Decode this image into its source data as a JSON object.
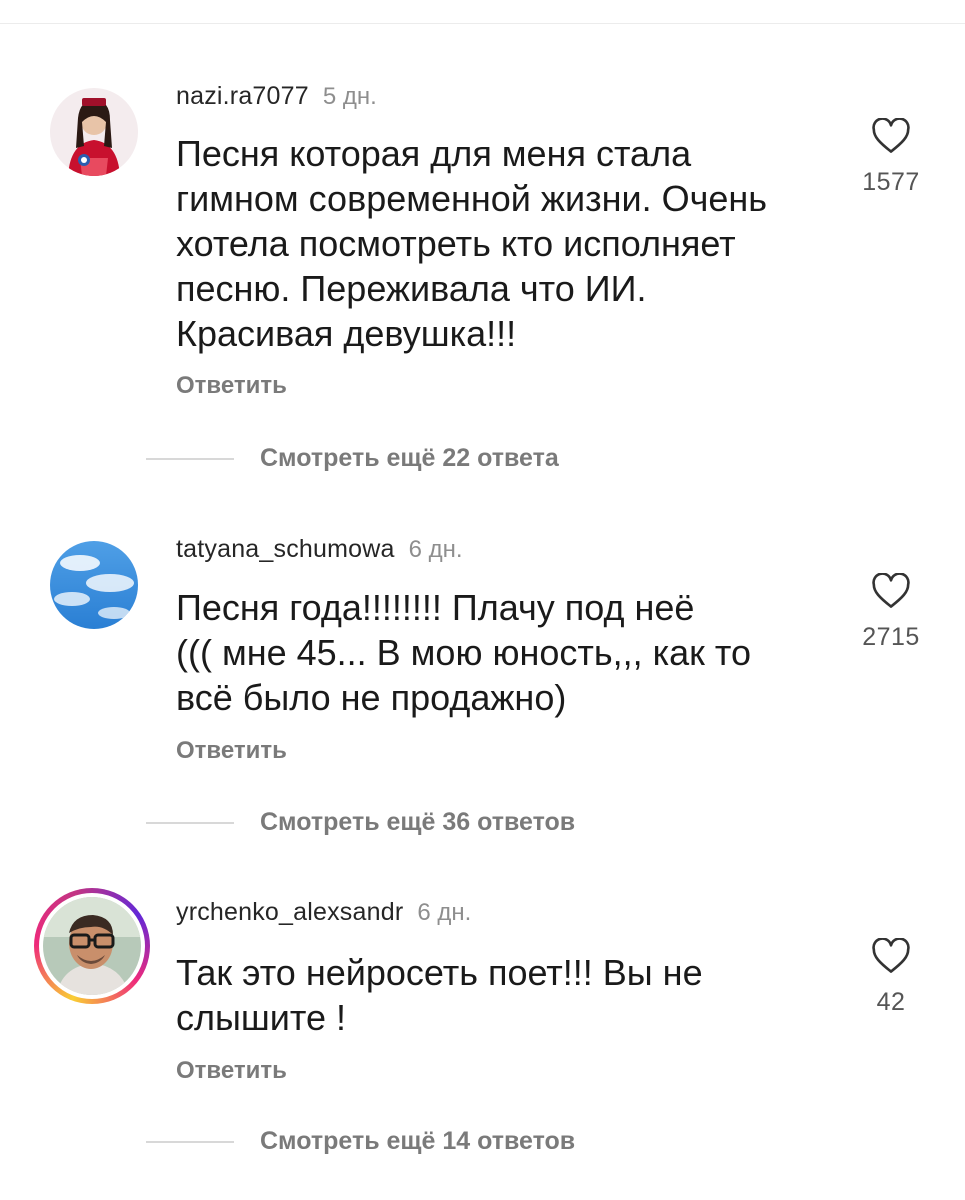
{
  "comments": [
    {
      "username": "nazi.ra7077",
      "time": "5 дн.",
      "text": "Песня которая для меня стала\nгимном современной жизни.  Очень\nхотела посмотреть кто исполняет\nпесню.  Переживала что ИИ.\nКрасивая девушка!!!",
      "likes": "1577",
      "reply_label": "Ответить",
      "more_replies": "Смотреть ещё 22 ответа",
      "avatar_icon": "avatar-woman-traditional-dress"
    },
    {
      "username": "tatyana_schumowa",
      "time": "6 дн.",
      "text": "Песня года!!!!!!!! Плачу под неё\n((( мне 45... В мою юность,,, как то\nвсё было не продажно)",
      "likes": "2715",
      "reply_label": "Ответить",
      "more_replies": "Смотреть ещё 36 ответов",
      "avatar_icon": "avatar-blue-sky-clouds"
    },
    {
      "username": "yrchenko_alexsandr",
      "time": "6 дн.",
      "text": "Так это нейросеть поет!!! Вы не\nслышите !",
      "likes": "42",
      "reply_label": "Ответить",
      "more_replies": "Смотреть ещё 14 ответов",
      "avatar_icon": "avatar-man-glasses",
      "has_story_ring": true
    }
  ],
  "colors": {
    "username": "#262626",
    "secondary": "#8e8e8e",
    "reply": "#7a7a7a",
    "story_ring": [
      "#f9ce34",
      "#ee2a7b",
      "#6228d7"
    ]
  }
}
